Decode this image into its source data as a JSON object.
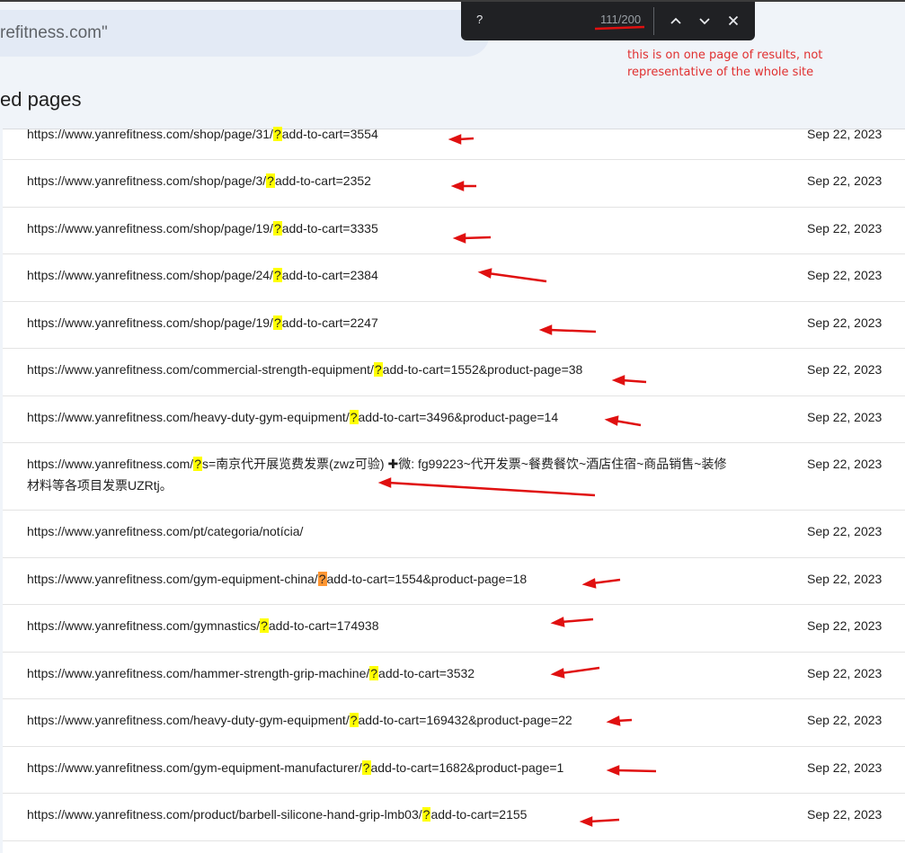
{
  "header": {
    "search_text": "refitness.com\"",
    "section_title": "ed pages"
  },
  "find_bar": {
    "query": "?",
    "count": "111/200",
    "prev_icon": "chevron-up-icon",
    "next_icon": "chevron-down-icon",
    "close_icon": "close-icon"
  },
  "annotation": {
    "note": "this is on one page of results, not representative of the whole site",
    "color": "#e03030"
  },
  "colors": {
    "match_highlight": "#ffff00",
    "active_match_highlight": "#ff9632",
    "header_bg": "#f0f4f9"
  },
  "rows": [
    {
      "pre": "https://www.yanrefitness.com/shop/page/31/",
      "match": "?",
      "post": "add-to-cart=3554",
      "date": "Sep 22, 2023"
    },
    {
      "pre": "https://www.yanrefitness.com/shop/page/3/",
      "match": "?",
      "post": "add-to-cart=2352",
      "date": "Sep 22, 2023"
    },
    {
      "pre": "https://www.yanrefitness.com/shop/page/19/",
      "match": "?",
      "post": "add-to-cart=3335",
      "date": "Sep 22, 2023"
    },
    {
      "pre": "https://www.yanrefitness.com/shop/page/24/",
      "match": "?",
      "post": "add-to-cart=2384",
      "date": "Sep 22, 2023"
    },
    {
      "pre": "https://www.yanrefitness.com/shop/page/19/",
      "match": "?",
      "post": "add-to-cart=2247",
      "date": "Sep 22, 2023"
    },
    {
      "pre": "https://www.yanrefitness.com/commercial-strength-equipment/",
      "match": "?",
      "post": "add-to-cart=1552&product-page=38",
      "date": "Sep 22, 2023"
    },
    {
      "pre": "https://www.yanrefitness.com/heavy-duty-gym-equipment/",
      "match": "?",
      "post": "add-to-cart=3496&product-page=14",
      "date": "Sep 22, 2023"
    },
    {
      "pre": "https://www.yanrefitness.com/",
      "match": "?",
      "post": "s=南京代开展览费发票(zwz可验) ✚微: fg99223~代开发票~餐费餐饮~酒店住宿~商品销售~装修材料等各项目发票UZRtj。",
      "date": "Sep 22, 2023"
    },
    {
      "pre": "https://www.yanrefitness.com/pt/categoria/notícia/",
      "match": "",
      "post": "",
      "date": "Sep 22, 2023"
    },
    {
      "pre": "https://www.yanrefitness.com/gym-equipment-china/",
      "match": "?",
      "post": "add-to-cart=1554&product-page=18",
      "date": "Sep 22, 2023",
      "active": true
    },
    {
      "pre": "https://www.yanrefitness.com/gymnastics/",
      "match": "?",
      "post": "add-to-cart=174938",
      "date": "Sep 22, 2023"
    },
    {
      "pre": "https://www.yanrefitness.com/hammer-strength-grip-machine/",
      "match": "?",
      "post": "add-to-cart=3532",
      "date": "Sep 22, 2023"
    },
    {
      "pre": "https://www.yanrefitness.com/heavy-duty-gym-equipment/",
      "match": "?",
      "post": "add-to-cart=169432&product-page=22",
      "date": "Sep 22, 2023"
    },
    {
      "pre": "https://www.yanrefitness.com/gym-equipment-manufacturer/",
      "match": "?",
      "post": "add-to-cart=1682&product-page=1",
      "date": "Sep 22, 2023"
    },
    {
      "pre": "https://www.yanrefitness.com/product/barbell-silicone-hand-grip-lmb03/",
      "match": "?",
      "post": "add-to-cart=2155",
      "date": "Sep 22, 2023"
    }
  ]
}
